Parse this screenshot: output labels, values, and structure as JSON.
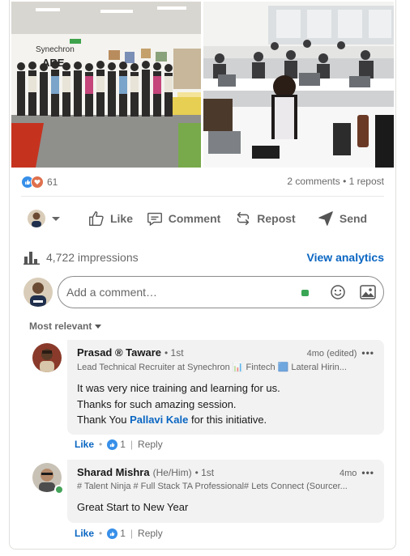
{
  "post": {
    "photos": [
      {
        "name": "group-photo-office",
        "sign_text": "Synechron",
        "sign_text_2": "ARE"
      },
      {
        "name": "training-room-photo"
      }
    ],
    "reaction_count": "61",
    "comments_reposts": "2 comments • 1 repost"
  },
  "actions": {
    "like": "Like",
    "comment": "Comment",
    "repost": "Repost",
    "send": "Send"
  },
  "impressions": {
    "count": "4,722 impressions",
    "analytics_link": "View analytics"
  },
  "comment_box": {
    "placeholder": "Add a comment…"
  },
  "sort": {
    "label": "Most relevant"
  },
  "comments": [
    {
      "name": "Prasad ® Taware",
      "degree": "• 1st",
      "time": "4mo (edited)",
      "headline": "Lead Technical Recruiter at Synechron 📊 Fintech 🟦 Lateral Hirin...",
      "body_lines": [
        "It was very nice training and learning for us.",
        "Thanks for such amazing session.",
        "Thank You"
      ],
      "mention": "Pallavi Kale",
      "body_tail": " for this initiative.",
      "like_label": "Like",
      "like_count": "1",
      "reply_label": "Reply"
    },
    {
      "name": "Sharad Mishra",
      "pronouns": "(He/Him)",
      "degree": "• 1st",
      "time": "4mo",
      "headline": "# Talent Ninja # Full Stack TA Professional# Lets Connect (Sourcer...",
      "body": "Great Start to New Year",
      "like_label": "Like",
      "like_count": "1",
      "reply_label": "Reply"
    }
  ],
  "colors": {
    "brand_blue": "#0a66c2",
    "like_blue": "#378fe9",
    "love_red": "#df704d",
    "bubble_bg": "#f2f2f2"
  }
}
